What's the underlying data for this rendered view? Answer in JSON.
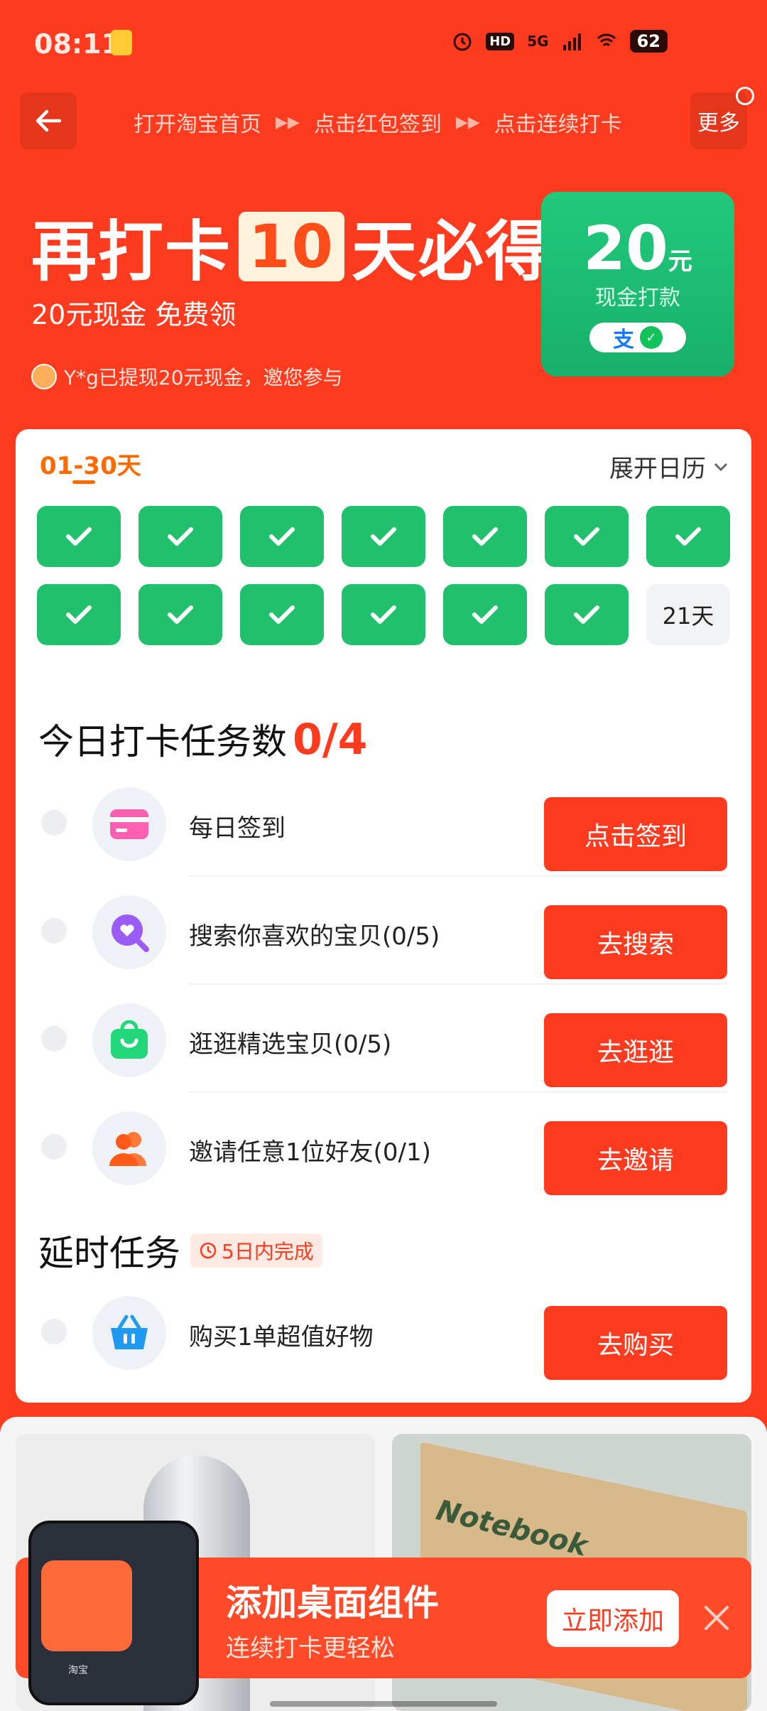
{
  "status_bar": {
    "time": "08:11",
    "network": "5G",
    "battery": "62",
    "hd": "HD"
  },
  "nav": {
    "steps": [
      "打开淘宝首页",
      "点击红包签到",
      "点击连续打卡"
    ],
    "more_label": "更多"
  },
  "hero": {
    "title_prefix": "再打卡",
    "days_left": "10",
    "title_suffix": "天必得",
    "subtitle": "20元现金 免费领",
    "note": "Y*g已提现20元现金，邀您参与",
    "reward_amount": "20",
    "reward_unit": "元",
    "reward_label": "现金打款",
    "pay_alipay": "支"
  },
  "calendar": {
    "range_tab": "01-30天",
    "expand_label": "展开日历",
    "checked_days": 13,
    "next_day_label": "21天"
  },
  "today": {
    "title": "今日打卡任务数",
    "count": "0/4",
    "tasks": [
      {
        "label": "每日签到",
        "button": "点击签到",
        "icon": "card-icon"
      },
      {
        "label": "搜索你喜欢的宝贝(0/5)",
        "button": "去搜索",
        "icon": "search-heart-icon"
      },
      {
        "label": "逛逛精选宝贝(0/5)",
        "button": "去逛逛",
        "icon": "shopping-bag-icon"
      },
      {
        "label": "邀请任意1位好友(0/1)",
        "button": "去邀请",
        "icon": "users-icon"
      }
    ]
  },
  "delay": {
    "title": "延时任务",
    "badge": "5日内完成",
    "tasks": [
      {
        "label": "购买1单超值好物",
        "button": "去购买",
        "icon": "basket-icon"
      }
    ]
  },
  "products": {
    "item2_text": "Notebook"
  },
  "banner": {
    "title": "添加桌面组件",
    "subtitle": "连续打卡更轻松",
    "add_label": "立即添加",
    "widget_label": "淘宝"
  },
  "colors": {
    "brand": "#ff3b1f",
    "check": "#21c06c",
    "orange": "#ff6a00"
  }
}
